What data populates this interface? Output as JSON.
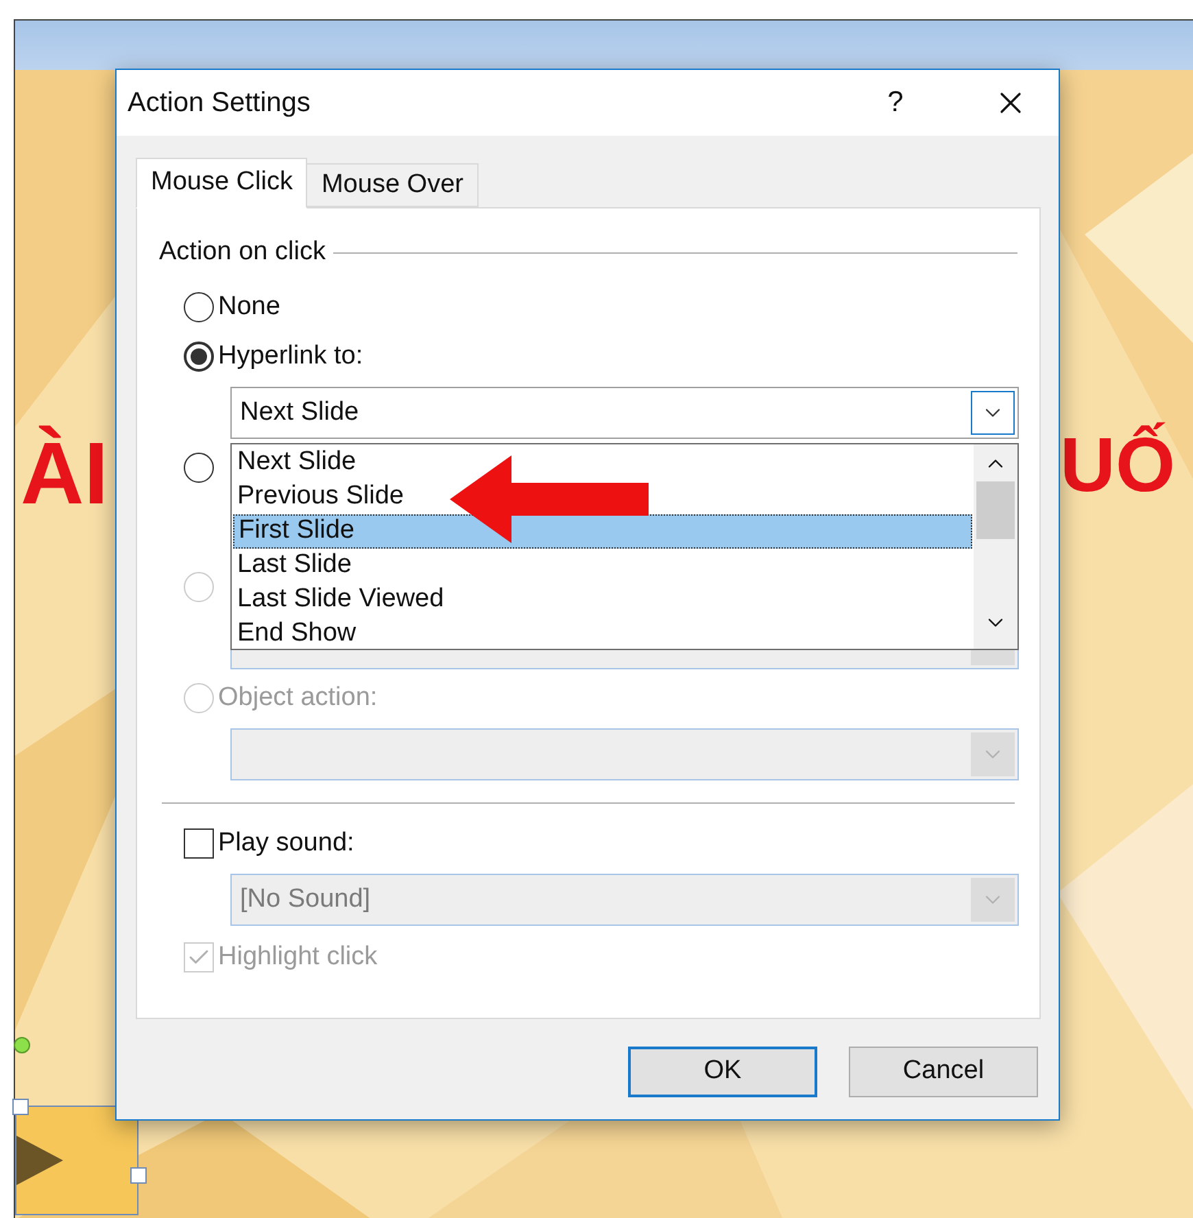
{
  "slide": {
    "texts": [
      "ÀI",
      "UỐ"
    ]
  },
  "window": {
    "title": "Action Settings",
    "help": "?"
  },
  "tabs": [
    {
      "label": "Mouse Click",
      "selected": true
    },
    {
      "label": "Mouse Over",
      "selected": false
    }
  ],
  "group_label": "Action on click",
  "actions": [
    {
      "label": "None",
      "selected": false,
      "disabled": false
    },
    {
      "label": "Hyperlink to:",
      "selected": true,
      "disabled": false,
      "field": {
        "kind": "combo",
        "value": "Next Slide",
        "focused": true
      }
    },
    {
      "selected": false,
      "disabled": false
    },
    {
      "selected": false,
      "disabled": true,
      "field": {
        "kind": "combo",
        "focused": false
      }
    },
    {
      "label": "Object action:",
      "selected": false,
      "disabled": true,
      "field": {
        "kind": "combo",
        "focused": false
      }
    }
  ],
  "dropdown_list": [
    {
      "label": "Next Slide",
      "selected": false
    },
    {
      "label": "Previous Slide",
      "selected": false
    },
    {
      "label": "First Slide",
      "selected": true
    },
    {
      "label": "Last Slide",
      "selected": false
    },
    {
      "label": "Last Slide Viewed",
      "selected": false
    },
    {
      "label": "End Show",
      "selected": false
    }
  ],
  "sound": {
    "label": "Play sound:",
    "checked": false,
    "value": "[No Sound]",
    "disabled": true
  },
  "highlight": {
    "label": "Highlight click",
    "checked": true,
    "disabled": true
  },
  "buttons": [
    {
      "label": "OK",
      "default": true
    },
    {
      "label": "Cancel",
      "default": false
    }
  ]
}
